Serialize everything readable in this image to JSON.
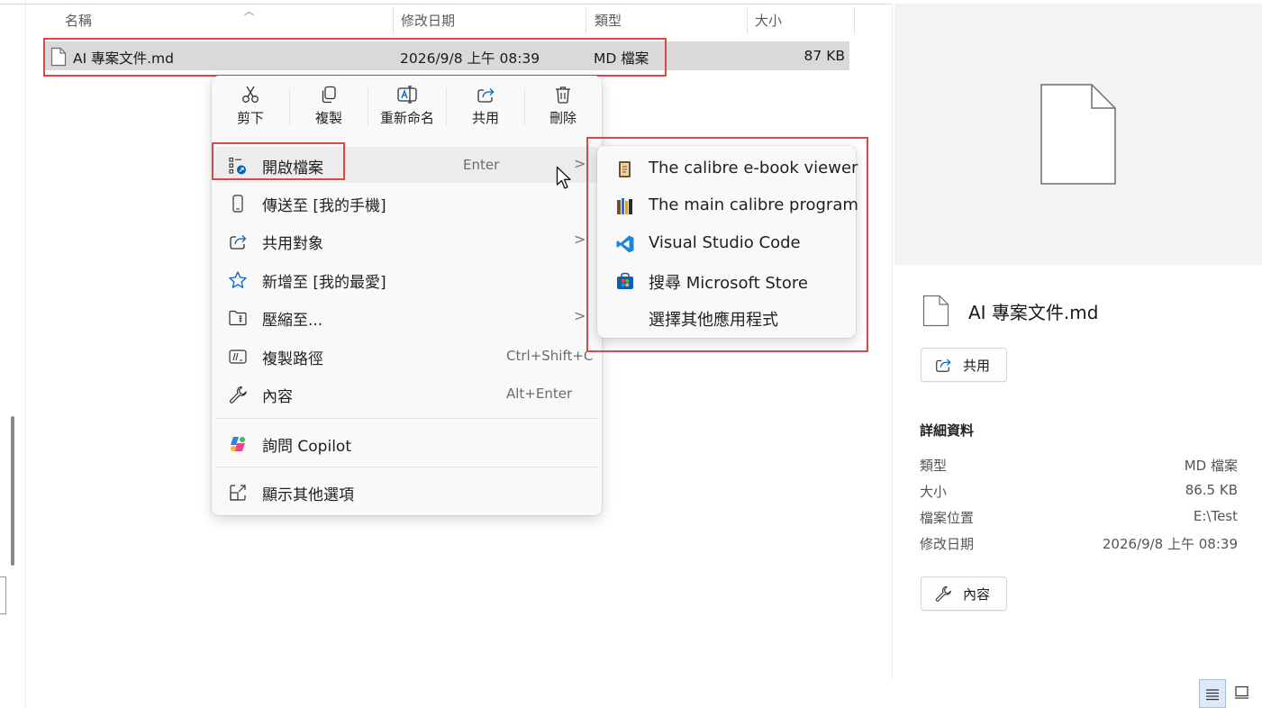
{
  "columns": {
    "name": "名稱",
    "modified": "修改日期",
    "type": "類型",
    "size": "大小"
  },
  "file": {
    "name": "AI 專案文件.md",
    "modified": "2026/9/8 上午 08:39",
    "type": "MD 檔案",
    "size": "87 KB"
  },
  "context_menu": {
    "toolbar": [
      {
        "label": "剪下",
        "icon": "cut-icon"
      },
      {
        "label": "複製",
        "icon": "copy-icon"
      },
      {
        "label": "重新命名",
        "icon": "rename-icon"
      },
      {
        "label": "共用",
        "icon": "share-icon"
      },
      {
        "label": "刪除",
        "icon": "delete-icon"
      }
    ],
    "items": [
      {
        "label": "開啟檔案",
        "shortcut": "Enter",
        "icon": "open-with-icon",
        "submenu": true
      },
      {
        "label": "傳送至 [我的手機]",
        "icon": "phone-icon"
      },
      {
        "label": "共用對象",
        "icon": "share-icon",
        "submenu": true
      },
      {
        "label": "新增至 [我的最愛]",
        "icon": "star-icon"
      },
      {
        "label": "壓縮至...",
        "icon": "zip-folder-icon",
        "submenu": true
      },
      {
        "label": "複製路徑",
        "shortcut": "Ctrl+Shift+C",
        "icon": "copy-path-icon"
      },
      {
        "label": "內容",
        "shortcut": "Alt+Enter",
        "icon": "wrench-icon"
      },
      {
        "label": "詢問 Copilot",
        "icon": "copilot-icon"
      },
      {
        "label": "顯示其他選項",
        "icon": "more-options-icon"
      }
    ]
  },
  "open_with_submenu": [
    {
      "label": "The calibre e-book viewer",
      "icon": "calibre-viewer-icon"
    },
    {
      "label": "The main calibre program",
      "icon": "calibre-icon"
    },
    {
      "label": "Visual Studio Code",
      "icon": "vscode-icon"
    },
    {
      "label": "搜尋 Microsoft Store",
      "icon": "microsoft-store-icon"
    },
    {
      "label": "選擇其他應用程式",
      "icon": ""
    }
  ],
  "details_pane": {
    "title": "AI 專案文件.md",
    "share_label": "共用",
    "section_title": "詳細資料",
    "rows": [
      {
        "key": "類型",
        "value": "MD 檔案"
      },
      {
        "key": "大小",
        "value": "86.5 KB"
      },
      {
        "key": "檔案位置",
        "value": "E:\\Test"
      },
      {
        "key": "修改日期",
        "value": "2026/9/8 上午 08:39"
      }
    ],
    "properties_label": "內容"
  },
  "colors": {
    "highlight_box": "#e0454a",
    "selected_row": "#d9d9d9",
    "menu_bg": "#f9f9f9",
    "accent": "#0067c0"
  }
}
